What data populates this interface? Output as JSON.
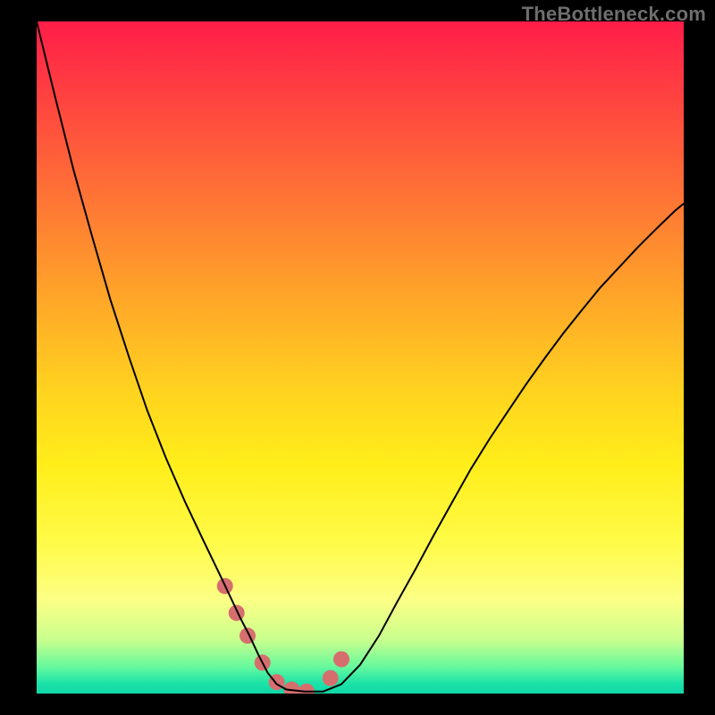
{
  "watermark": "TheBottleneck.com",
  "colors": {
    "curve_stroke": "#000000",
    "marker_fill": "#d66e6e",
    "background_frame": "#000000"
  },
  "chart_data": {
    "type": "line",
    "title": "",
    "xlabel": "",
    "ylabel": "",
    "xlim": [
      0,
      1
    ],
    "ylim": [
      0,
      1
    ],
    "annotations": [],
    "series": [
      {
        "name": "bottleneck-curve",
        "x": [
          0.0,
          0.029,
          0.057,
          0.086,
          0.114,
          0.143,
          0.171,
          0.2,
          0.229,
          0.257,
          0.286,
          0.314,
          0.329,
          0.343,
          0.357,
          0.371,
          0.386,
          0.414,
          0.443,
          0.471,
          0.5,
          0.529,
          0.557,
          0.586,
          0.614,
          0.643,
          0.671,
          0.7,
          0.729,
          0.757,
          0.786,
          0.814,
          0.843,
          0.871,
          0.9,
          0.929,
          0.957,
          0.986,
          1.0
        ],
        "y": [
          1.0,
          0.886,
          0.779,
          0.679,
          0.586,
          0.5,
          0.421,
          0.35,
          0.286,
          0.229,
          0.171,
          0.114,
          0.086,
          0.057,
          0.031,
          0.014,
          0.006,
          0.003,
          0.003,
          0.014,
          0.043,
          0.086,
          0.136,
          0.186,
          0.236,
          0.286,
          0.334,
          0.379,
          0.421,
          0.461,
          0.5,
          0.536,
          0.571,
          0.604,
          0.634,
          0.664,
          0.691,
          0.718,
          0.729
        ]
      },
      {
        "name": "highlight-markers",
        "x": [
          0.291,
          0.309,
          0.326,
          0.349,
          0.371,
          0.394,
          0.417,
          0.454,
          0.471
        ],
        "y": [
          0.16,
          0.12,
          0.086,
          0.046,
          0.017,
          0.006,
          0.003,
          0.023,
          0.051
        ]
      }
    ]
  }
}
